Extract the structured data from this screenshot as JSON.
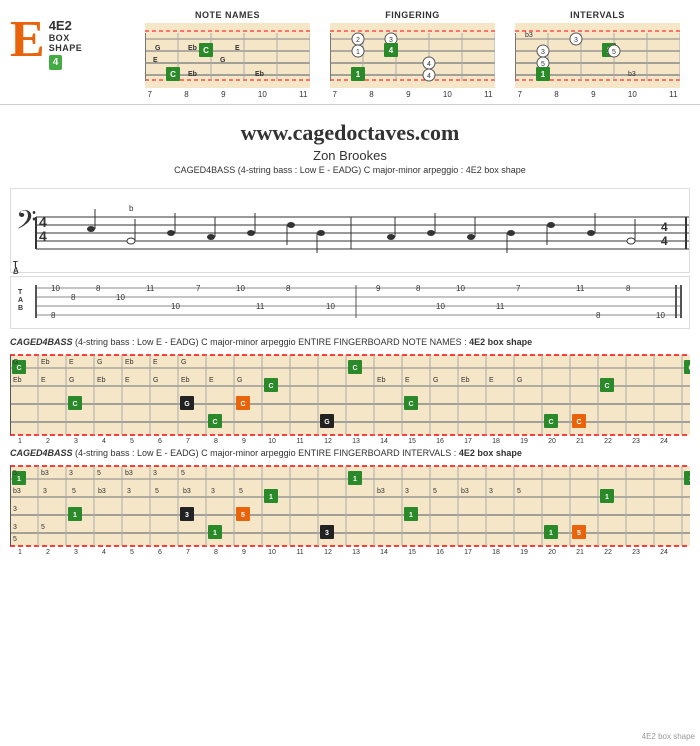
{
  "page": {
    "title": "CAGED4BASS - 4E2 Box Shape",
    "website": "www.cagedoctaves.com",
    "author": "Zon Brookes",
    "subtitle": "CAGED4BASS (4-string bass : Low E - EADG) C major-minor arpeggio : 4E2 box shape"
  },
  "chord": {
    "letter": "E",
    "name": "4E2",
    "sub1": "BOX",
    "sub2": "SHAPE",
    "fret": "4"
  },
  "diagrams": {
    "note_names": {
      "title": "NOTE NAMES",
      "fret_numbers": [
        "7",
        "8",
        "9",
        "10",
        "11"
      ]
    },
    "fingering": {
      "title": "FINGERING",
      "fret_numbers": [
        "7",
        "8",
        "9",
        "10",
        "11"
      ]
    },
    "intervals": {
      "title": "INTERVALS",
      "fret_numbers": [
        "7",
        "8",
        "9",
        "10",
        "11"
      ]
    }
  },
  "full_fingerboard_notes": {
    "title1_pre": "CAGED4BASS",
    "title1_mid": "(4-string bass : Low E - EADG) C major-minor arpeggio ENTIRE FINGERBOARD NOTE NAMES :",
    "title1_post": "4E2 box shape",
    "title2_pre": "CAGED4BASS",
    "title2_mid": "(4-string bass : Low E - EADG) C major-minor arpeggio ENTIRE FINGERBOARD INTERVALS :",
    "title2_post": "4E2 box shape",
    "fret_numbers": [
      "1",
      "2",
      "3",
      "4",
      "5",
      "6",
      "7",
      "8",
      "9",
      "10",
      "11",
      "12",
      "13",
      "14",
      "15",
      "16",
      "17",
      "18",
      "19",
      "20",
      "21",
      "22",
      "23",
      "24"
    ]
  },
  "colors": {
    "green": "#2a8a2a",
    "orange": "#e8630a",
    "black": "#222",
    "red_dashed": "#cc0000"
  }
}
